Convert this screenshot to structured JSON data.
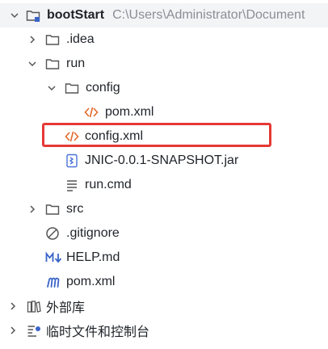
{
  "tree": {
    "root": {
      "name": "bootStart",
      "path": "C:\\Users\\Administrator\\Document"
    },
    "items": [
      {
        "label": ".idea"
      },
      {
        "label": "run"
      },
      {
        "label": "config"
      },
      {
        "label": "pom.xml"
      },
      {
        "label": "config.xml"
      },
      {
        "label": "JNIC-0.0.1-SNAPSHOT.jar"
      },
      {
        "label": "run.cmd"
      },
      {
        "label": "src"
      },
      {
        "label": ".gitignore"
      },
      {
        "label": "HELP.md"
      },
      {
        "label": "pom.xml"
      },
      {
        "label": "外部库"
      },
      {
        "label": "临时文件和控制台"
      }
    ]
  },
  "icons": {
    "folder": "folder-icon",
    "xml": "xml-file-icon",
    "jar": "jar-file-icon",
    "text": "text-file-icon",
    "ignore": "gitignore-icon",
    "markdown": "markdown-icon",
    "maven": "maven-icon",
    "library": "library-icon",
    "scratch": "scratches-icon"
  },
  "colors": {
    "xml_icon": "#e36a2c",
    "jar_icon": "#4a73d6",
    "maven_icon": "#3a64c8",
    "markdown_icon": "#3a64c8",
    "highlight": "#e53935",
    "path_text": "#8a8e96"
  }
}
